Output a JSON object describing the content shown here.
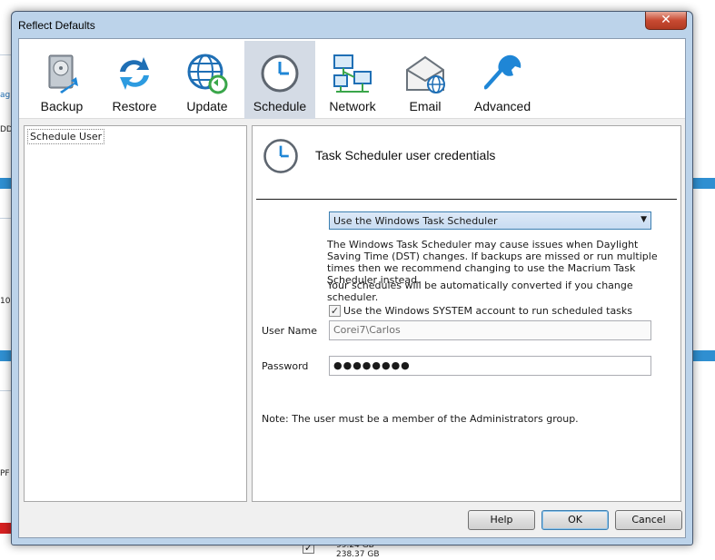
{
  "background": {
    "left_texts": [
      "ag",
      "DD",
      "10",
      "PF"
    ],
    "sizes": [
      "99.24 GB",
      "238.37 GB"
    ]
  },
  "window": {
    "title": "Reflect Defaults",
    "close_glyph": "✕"
  },
  "toolbar": {
    "items": [
      {
        "label": "Backup",
        "icon": "backup-disk-icon"
      },
      {
        "label": "Restore",
        "icon": "restore-arrows-icon"
      },
      {
        "label": "Update",
        "icon": "update-globe-icon"
      },
      {
        "label": "Schedule",
        "icon": "schedule-clock-icon",
        "active": true
      },
      {
        "label": "Network",
        "icon": "network-computers-icon"
      },
      {
        "label": "Email",
        "icon": "email-envelope-icon"
      },
      {
        "label": "Advanced",
        "icon": "advanced-wrench-icon"
      }
    ]
  },
  "sidebar": {
    "items": [
      {
        "label": "Schedule User",
        "selected": true
      }
    ]
  },
  "panel": {
    "title": "Task Scheduler user credentials",
    "scheduler_select": {
      "value": "Use the Windows Task Scheduler",
      "arrow": "▼"
    },
    "dst_warning": "The Windows Task Scheduler may cause issues when Daylight Saving Time (DST) changes. If backups are missed or run multiple times then we recommend changing to use the Macrium Task Scheduler instead.",
    "convert_note": "Your schedules will be automatically converted if you change scheduler.",
    "system_account": {
      "label": "Use the Windows SYSTEM account to run scheduled tasks",
      "checked": true,
      "check_glyph": "✓"
    },
    "username": {
      "label": "User Name",
      "value": "Corei7\\Carlos"
    },
    "password": {
      "label": "Password",
      "value": "●●●●●●●●"
    },
    "note": "Note: The user must be a member of the Administrators group."
  },
  "buttons": {
    "help": "Help",
    "ok": "OK",
    "cancel": "Cancel"
  },
  "colors": {
    "accent": "#1f86d6",
    "active_tab": "#d4dbe5",
    "close": "#c84a32"
  }
}
